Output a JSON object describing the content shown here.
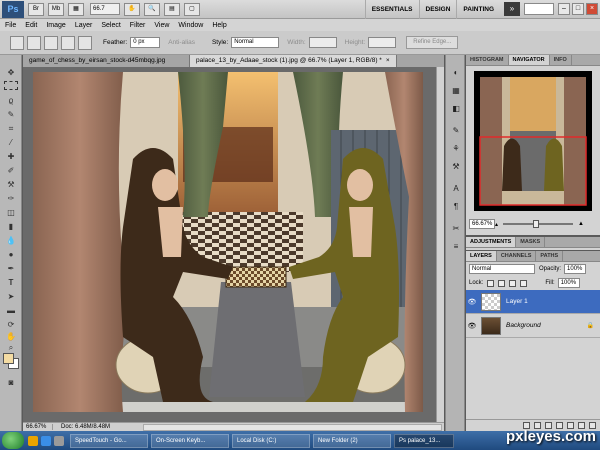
{
  "app": {
    "logo": "Ps",
    "zoom": "66.7",
    "workspaces": [
      "ESSENTIALS",
      "DESIGN",
      "PAINTING"
    ],
    "more": "»"
  },
  "menu": [
    "File",
    "Edit",
    "Image",
    "Layer",
    "Select",
    "Filter",
    "View",
    "Window",
    "Help"
  ],
  "options": {
    "feather_label": "Feather:",
    "feather_value": "0 px",
    "antialias_label": "Anti-alias",
    "style_label": "Style:",
    "style_value": "Normal",
    "width_label": "Width:",
    "height_label": "Height:",
    "refine_edge": "Refine Edge..."
  },
  "tabs": [
    {
      "label": "game_of_chess_by_eirsan_stock-d45mbqg.jpg"
    },
    {
      "label": "palace_13_by_Adaae_stock (1).jpg @ 66.7% (Layer 1, RGB/8) *"
    }
  ],
  "status": {
    "zoom": "66.67%",
    "doc": "Doc: 6.48M/8.48M"
  },
  "navigator": {
    "tabs": [
      "HISTOGRAM",
      "NAVIGATOR",
      "INFO"
    ],
    "zoom": "66.67%"
  },
  "adjustments": {
    "tabs": [
      "ADJUSTMENTS",
      "MASKS"
    ]
  },
  "layers": {
    "tabs": [
      "LAYERS",
      "CHANNELS",
      "PATHS"
    ],
    "blend": "Normal",
    "opacity_label": "Opacity:",
    "opacity": "100%",
    "lock_label": "Lock:",
    "fill_label": "Fill:",
    "fill": "100%",
    "items": [
      {
        "name": "Layer 1",
        "selected": true
      },
      {
        "name": "Background",
        "selected": false
      }
    ]
  },
  "taskbar": {
    "items": [
      "SpeedTouch - Go...",
      "On-Screen Keyb...",
      "Local Disk (C:)",
      "New Folder (2)",
      "Ps palace_13..."
    ]
  },
  "watermark": "pxleyes.com"
}
